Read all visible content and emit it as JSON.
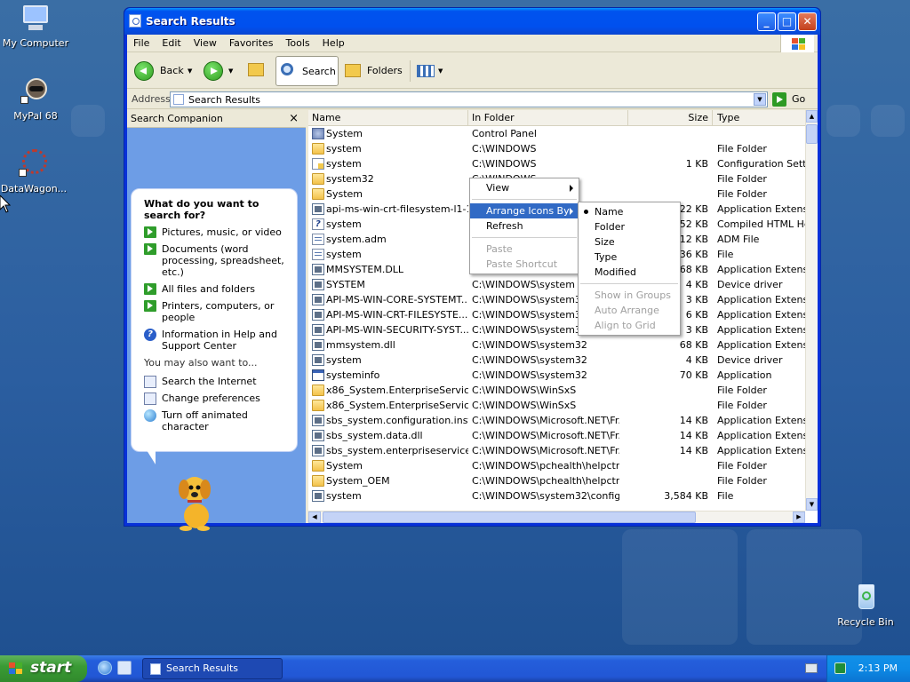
{
  "desktop": {
    "icons": [
      {
        "label": "My Computer"
      },
      {
        "label": "MyPal 68"
      },
      {
        "label": "DataWagon..."
      },
      {
        "label": "Recycle Bin"
      }
    ]
  },
  "window": {
    "title": "Search Results",
    "menu": [
      "File",
      "Edit",
      "View",
      "Favorites",
      "Tools",
      "Help"
    ],
    "toolbar": {
      "back": "Back",
      "search": "Search",
      "folders": "Folders"
    },
    "address": {
      "label": "Address",
      "value": "Search Results",
      "go": "Go"
    }
  },
  "search_companion": {
    "title": "Search Companion",
    "close": "×",
    "question": "What do you want to search for?",
    "options": [
      "Pictures, music, or video",
      "Documents (word processing, spreadsheet, etc.)",
      "All files and folders",
      "Printers, computers, or people",
      "Information in Help and Support Center"
    ],
    "also_label": "You may also want to...",
    "also": [
      "Search the Internet",
      "Change preferences",
      "Turn off animated character"
    ]
  },
  "list": {
    "columns": [
      "Name",
      "In Folder",
      "Size",
      "Type"
    ],
    "rows": [
      {
        "icon": "cpl",
        "name": "System",
        "folder": "Control Panel",
        "size": "",
        "type": ""
      },
      {
        "icon": "folder",
        "name": "system",
        "folder": "C:\\WINDOWS",
        "size": "",
        "type": "File Folder"
      },
      {
        "icon": "ini",
        "name": "system",
        "folder": "C:\\WINDOWS",
        "size": "1 KB",
        "type": "Configuration Settings"
      },
      {
        "icon": "folder",
        "name": "system32",
        "folder": "C:\\WINDOWS",
        "size": "",
        "type": "File Folder"
      },
      {
        "icon": "folder",
        "name": "System",
        "folder": "C:\\Program Files",
        "size": "",
        "type": "File Folder"
      },
      {
        "icon": "sys",
        "name": "api-ms-win-crt-filesystem-l1-1...",
        "folder": "",
        "size": "22 KB",
        "type": "Application Extension"
      },
      {
        "icon": "help",
        "name": "system",
        "folder": "",
        "size": "452 KB",
        "type": "Compiled HTML Help"
      },
      {
        "icon": "file",
        "name": "system.adm",
        "folder": "",
        "size": "712 KB",
        "type": "ADM File"
      },
      {
        "icon": "file",
        "name": "system",
        "folder": "",
        "size": "136 KB",
        "type": "File"
      },
      {
        "icon": "sys",
        "name": "MMSYSTEM.DLL",
        "folder": "",
        "size": "68 KB",
        "type": "Application Extension"
      },
      {
        "icon": "sys",
        "name": "SYSTEM",
        "folder": "C:\\WINDOWS\\system",
        "size": "4 KB",
        "type": "Device driver"
      },
      {
        "icon": "sys",
        "name": "API-MS-WIN-CORE-SYSTEMT...",
        "folder": "C:\\WINDOWS\\system32",
        "size": "3 KB",
        "type": "Application Extension"
      },
      {
        "icon": "sys",
        "name": "API-MS-WIN-CRT-FILESYSTE...",
        "folder": "C:\\WINDOWS\\system32",
        "size": "6 KB",
        "type": "Application Extension"
      },
      {
        "icon": "sys",
        "name": "API-MS-WIN-SECURITY-SYST...",
        "folder": "C:\\WINDOWS\\system32",
        "size": "3 KB",
        "type": "Application Extension"
      },
      {
        "icon": "sys",
        "name": "mmsystem.dll",
        "folder": "C:\\WINDOWS\\system32",
        "size": "68 KB",
        "type": "Application Extension"
      },
      {
        "icon": "sys",
        "name": "system",
        "folder": "C:\\WINDOWS\\system32",
        "size": "4 KB",
        "type": "Device driver"
      },
      {
        "icon": "app",
        "name": "systeminfo",
        "folder": "C:\\WINDOWS\\system32",
        "size": "70 KB",
        "type": "Application"
      },
      {
        "icon": "folder",
        "name": "x86_System.EnterpriseServic...",
        "folder": "C:\\WINDOWS\\WinSxS",
        "size": "",
        "type": "File Folder"
      },
      {
        "icon": "folder",
        "name": "x86_System.EnterpriseServic...",
        "folder": "C:\\WINDOWS\\WinSxS",
        "size": "",
        "type": "File Folder"
      },
      {
        "icon": "sys",
        "name": "sbs_system.configuration.inst...",
        "folder": "C:\\WINDOWS\\Microsoft.NET\\Fr...",
        "size": "14 KB",
        "type": "Application Extension"
      },
      {
        "icon": "sys",
        "name": "sbs_system.data.dll",
        "folder": "C:\\WINDOWS\\Microsoft.NET\\Fr...",
        "size": "14 KB",
        "type": "Application Extension"
      },
      {
        "icon": "sys",
        "name": "sbs_system.enterpriseservice...",
        "folder": "C:\\WINDOWS\\Microsoft.NET\\Fr...",
        "size": "14 KB",
        "type": "Application Extension"
      },
      {
        "icon": "folder",
        "name": "System",
        "folder": "C:\\WINDOWS\\pchealth\\helpctr",
        "size": "",
        "type": "File Folder"
      },
      {
        "icon": "folder",
        "name": "System_OEM",
        "folder": "C:\\WINDOWS\\pchealth\\helpctr",
        "size": "",
        "type": "File Folder"
      },
      {
        "icon": "sys",
        "name": "system",
        "folder": "C:\\WINDOWS\\system32\\config",
        "size": "3,584 KB",
        "type": "File"
      }
    ]
  },
  "context_menu": {
    "items": [
      {
        "label": "View",
        "sub": true
      },
      {
        "label": "Arrange Icons By",
        "sub": true,
        "highlight": true
      },
      {
        "label": "Refresh"
      },
      {
        "label": "Paste",
        "disabled": true
      },
      {
        "label": "Paste Shortcut",
        "disabled": true
      }
    ]
  },
  "arrange_menu": {
    "items": [
      {
        "label": "Name",
        "checked": true
      },
      {
        "label": "Folder"
      },
      {
        "label": "Size"
      },
      {
        "label": "Type"
      },
      {
        "label": "Modified"
      },
      {
        "label": "Show in Groups",
        "disabled": true
      },
      {
        "label": "Auto Arrange",
        "disabled": true
      },
      {
        "label": "Align to Grid",
        "disabled": true
      }
    ]
  },
  "taskbar": {
    "start": "start",
    "task": "Search Results",
    "clock": "2:13 PM"
  },
  "colors": {
    "selection": "#316ac5",
    "title_bar": "#0050ee",
    "start_green": "#3a9b35"
  }
}
